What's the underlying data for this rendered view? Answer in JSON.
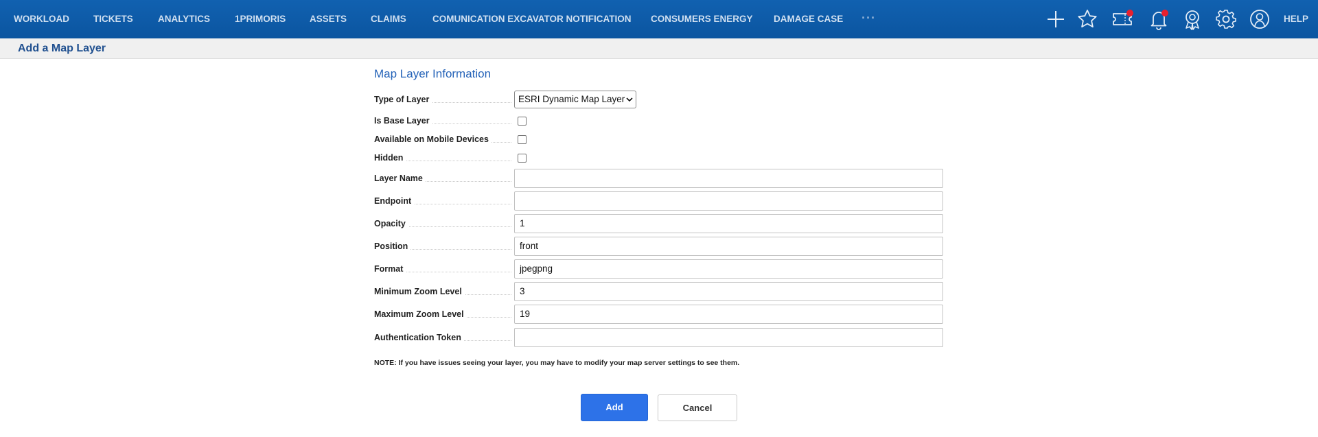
{
  "nav": {
    "items": [
      {
        "label": "WORKLOAD"
      },
      {
        "label": "TICKETS"
      },
      {
        "label": "ANALYTICS"
      },
      {
        "label": "1PRIMORIS"
      },
      {
        "label": "ASSETS"
      },
      {
        "label": "CLAIMS"
      },
      {
        "label": "COMUNICATION EXCAVATOR NOTIFICATION"
      },
      {
        "label": "CONSUMERS ENERGY"
      },
      {
        "label": "DAMAGE CASE"
      }
    ],
    "more": "···",
    "icons": [
      "plus-icon",
      "star-icon",
      "ticket-icon",
      "bell-icon",
      "award-icon",
      "gear-icon",
      "user-icon"
    ],
    "help": "HELP",
    "badge_color": "#e8202f"
  },
  "page": {
    "title": "Add a Map Layer"
  },
  "form": {
    "section_title": "Map Layer Information",
    "type_of_layer": {
      "label": "Type of Layer",
      "value": "ESRI Dynamic Map Layer"
    },
    "is_base_layer": {
      "label": "Is Base Layer",
      "checked": false
    },
    "available_mobile": {
      "label": "Available on Mobile Devices",
      "checked": false
    },
    "hidden": {
      "label": "Hidden",
      "checked": false
    },
    "layer_name": {
      "label": "Layer Name",
      "value": ""
    },
    "endpoint": {
      "label": "Endpoint",
      "value": ""
    },
    "opacity": {
      "label": "Opacity",
      "value": "1"
    },
    "position": {
      "label": "Position",
      "value": "front"
    },
    "format": {
      "label": "Format",
      "value": "jpegpng"
    },
    "min_zoom": {
      "label": "Minimum Zoom Level",
      "value": "3"
    },
    "max_zoom": {
      "label": "Maximum Zoom Level",
      "value": "19"
    },
    "auth_token": {
      "label": "Authentication Token",
      "value": ""
    },
    "note": "NOTE: If you have issues seeing your layer, you may have to modify your map server settings to see them."
  },
  "actions": {
    "add_label": "Add",
    "cancel_label": "Cancel",
    "accent_color": "#2d72e8"
  }
}
